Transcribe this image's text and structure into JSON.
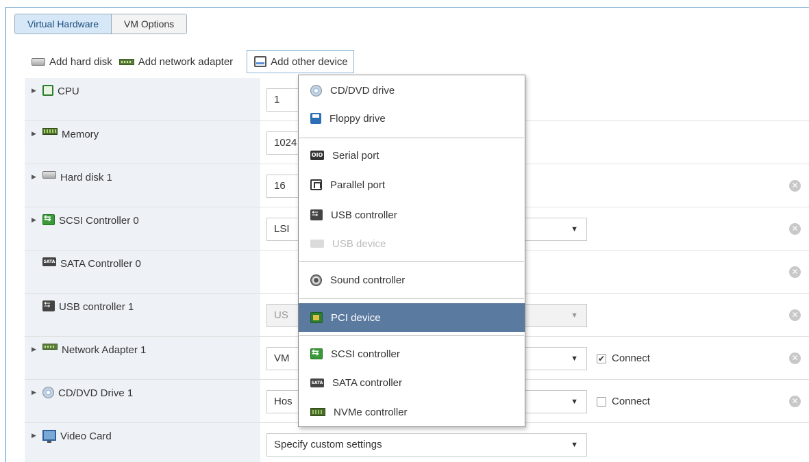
{
  "tabs": [
    {
      "label": "Virtual Hardware",
      "active": true
    },
    {
      "label": "VM Options",
      "active": false
    }
  ],
  "toolbar": {
    "add_hard_disk": "Add hard disk",
    "add_network_adapter": "Add network adapter",
    "add_other_device": "Add other device"
  },
  "rows": [
    {
      "label": "CPU",
      "value": "1",
      "expandable": true
    },
    {
      "label": "Memory",
      "value": "1024",
      "expandable": true
    },
    {
      "label": "Hard disk 1",
      "value": "16",
      "expandable": true
    },
    {
      "label": "SCSI Controller 0",
      "value": "LSI",
      "expandable": true
    },
    {
      "label": "SATA Controller 0",
      "value": "",
      "expandable": false
    },
    {
      "label": "USB controller 1",
      "value": "US",
      "expandable": false
    },
    {
      "label": "Network Adapter 1",
      "value": "VM",
      "expandable": true,
      "connect_label": "Connect",
      "connect_checked": true
    },
    {
      "label": "CD/DVD Drive 1",
      "value": "Hos",
      "expandable": true,
      "connect_label": "Connect",
      "connect_checked": false
    },
    {
      "label": "Video Card",
      "value": "Specify custom settings",
      "expandable": true
    }
  ],
  "menu": {
    "items": [
      {
        "label": "CD/DVD drive",
        "icon": "cd-icon",
        "disabled": false
      },
      {
        "label": "Floppy drive",
        "icon": "floppy-icon",
        "disabled": false
      },
      {
        "label": "Serial port",
        "icon": "serial-port-icon",
        "disabled": false
      },
      {
        "label": "Parallel port",
        "icon": "parallel-port-icon",
        "disabled": false
      },
      {
        "label": "USB controller",
        "icon": "usb-icon",
        "disabled": false
      },
      {
        "label": "USB device",
        "icon": "usb-device-icon",
        "disabled": true
      },
      {
        "label": "Sound controller",
        "icon": "sound-icon",
        "disabled": false
      },
      {
        "label": "PCI device",
        "icon": "pci-icon",
        "disabled": false,
        "highlighted": true
      },
      {
        "label": "SCSI controller",
        "icon": "scsi-icon",
        "disabled": false
      },
      {
        "label": "SATA controller",
        "icon": "sata-icon",
        "disabled": false
      },
      {
        "label": "NVMe controller",
        "icon": "nvme-icon",
        "disabled": false
      }
    ]
  },
  "icon_text": {
    "sata": "SATA",
    "serial": "OIO"
  },
  "glyphs": {
    "expand_arrow": "▶",
    "dropdown_caret": "▼",
    "remove": "✕",
    "check": "✔"
  },
  "colors": {
    "accent": "#4a90c8",
    "menu_highlight": "#5b7aa0",
    "label_bg": "#eef2f7"
  }
}
